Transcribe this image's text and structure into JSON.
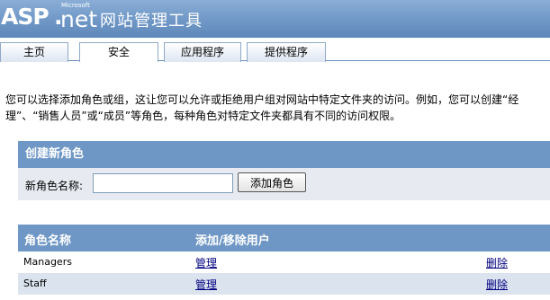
{
  "header": {
    "logo_asp": "ASP",
    "logo_dot": ".",
    "logo_net": "net",
    "logo_microsoft": "Microsoft",
    "title": "网站管理工具"
  },
  "tabs": [
    {
      "label": "主页",
      "active": false
    },
    {
      "label": "安全",
      "active": true
    },
    {
      "label": "应用程序",
      "active": false
    },
    {
      "label": "提供程序",
      "active": false
    }
  ],
  "intro": {
    "text": "您可以选择添加角色或组，这让您可以允许或拒绝用户组对网站中特定文件夹的访问。例如，您可以创建“经理”、“销售人员”或“成员”等角色，每种角色对特定文件夹都具有不同的访问权限。"
  },
  "create_role": {
    "title": "创建新角色",
    "field_label": "新角色名称:",
    "field_value": "",
    "button_label": "添加角色"
  },
  "roles_table": {
    "col_name": "角色名称",
    "col_manage": "添加/移除用户",
    "rows": [
      {
        "name": "Managers",
        "manage": "管理",
        "delete": "删除"
      },
      {
        "name": "Staff",
        "manage": "管理",
        "delete": "删除"
      }
    ]
  },
  "colors": {
    "header_blue": "#6f97c6",
    "row_alt": "#dbe3ef",
    "link": "#000080"
  }
}
